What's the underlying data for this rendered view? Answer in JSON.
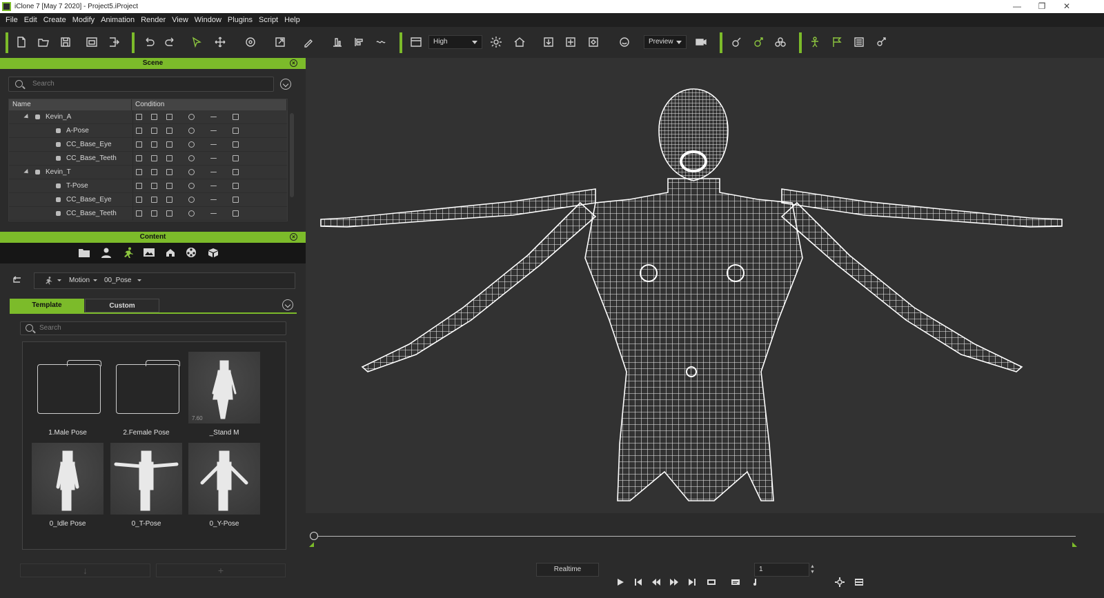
{
  "window": {
    "title": "iClone 7 [May  7 2020] - Project5.iProject",
    "controls": [
      "—",
      "❐",
      "✕"
    ]
  },
  "menu": [
    "File",
    "Edit",
    "Create",
    "Modify",
    "Animation",
    "Render",
    "View",
    "Window",
    "Plugins",
    "Script",
    "Help"
  ],
  "toolbar": {
    "quality": "High",
    "render_mode": "Preview"
  },
  "scene": {
    "title": "Scene",
    "search_placeholder": "Search",
    "columns": [
      "Name",
      "Condition"
    ],
    "rows": [
      {
        "name": "Kevin_A",
        "level": 0,
        "expandable": true
      },
      {
        "name": "A-Pose",
        "level": 1
      },
      {
        "name": "CC_Base_Eye",
        "level": 1
      },
      {
        "name": "CC_Base_Teeth",
        "level": 1
      },
      {
        "name": "Kevin_T",
        "level": 0,
        "expandable": true
      },
      {
        "name": "T-Pose",
        "level": 1
      },
      {
        "name": "CC_Base_Eye",
        "level": 1
      },
      {
        "name": "CC_Base_Teeth",
        "level": 1
      }
    ]
  },
  "content": {
    "title": "Content",
    "breadcrumb": [
      "Motion",
      "00_Pose"
    ],
    "tabs": {
      "template": "Template",
      "custom": "Custom"
    },
    "search_placeholder": "Search",
    "items": [
      {
        "label": "1.Male Pose",
        "kind": "folder"
      },
      {
        "label": "2.Female Pose",
        "kind": "folder"
      },
      {
        "label": "_Stand M",
        "kind": "figure",
        "badge": "7.60"
      },
      {
        "label": "0_Idle Pose",
        "kind": "figure"
      },
      {
        "label": "0_T-Pose",
        "kind": "figure"
      },
      {
        "label": "0_Y-Pose",
        "kind": "figure"
      }
    ]
  },
  "playback": {
    "mode": "Realtime",
    "frame": "1"
  },
  "colors": {
    "accent": "#7cbb2a",
    "panel": "#2b2b2b",
    "viewport": "#323232"
  }
}
